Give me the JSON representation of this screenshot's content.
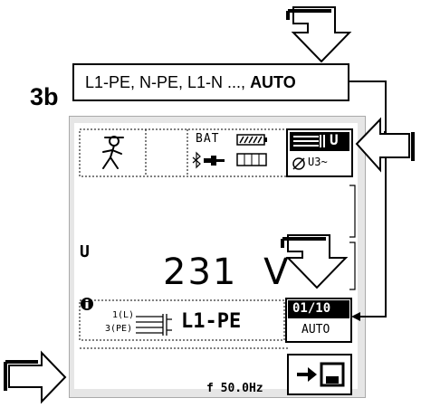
{
  "step_label": "3b",
  "callout": {
    "prefix": "L1-PE, N-PE, L1-N ..., ",
    "emphasis": "AUTO"
  },
  "status_bar": {
    "bat_label": "BAT",
    "mode_label": "U",
    "mode_sublabel": "U3~"
  },
  "measurement": {
    "quantity_label": "U",
    "value": "231",
    "unit": "V"
  },
  "connection": {
    "wire_top_label": "1(L)",
    "wire_bottom_label": "3(PE)",
    "polarity_label": "L1-PE",
    "counter": "01/10",
    "auto_button_label": "AUTO"
  },
  "footer": {
    "frequency": "f 50.0Hz"
  },
  "colors": {
    "screen_frame": "#e6e6e6",
    "ink": "#000000",
    "arrow_fill": "#ffffff"
  }
}
